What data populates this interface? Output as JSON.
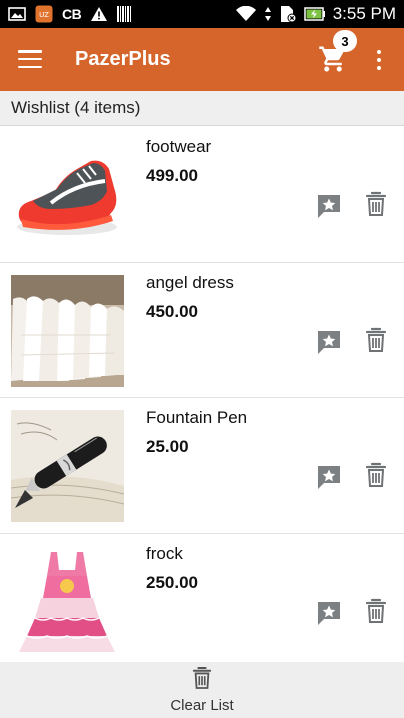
{
  "status_bar": {
    "time": "3:55 PM",
    "carrier_text": "CB",
    "icons": [
      "gallery-icon",
      "app-notification-icon",
      "carrier-cb-icon",
      "warning-icon",
      "barcode-icon",
      "wifi-icon",
      "data-arrows-icon",
      "no-sim-icon",
      "battery-charging-icon"
    ]
  },
  "app_bar": {
    "title": "PazerPlus",
    "cart_count": "3",
    "menu_icon": "hamburger-menu-icon",
    "cart_icon": "shopping-cart-icon",
    "overflow_icon": "more-vert-icon",
    "background": "#d5652b"
  },
  "wishlist": {
    "header": "Wishlist (4 items)",
    "items": [
      {
        "name": "footwear",
        "price": "499.00",
        "image": "red-sneaker-image"
      },
      {
        "name": "angel dress",
        "price": "450.00",
        "image": "white-dresses-image"
      },
      {
        "name": "Fountain Pen",
        "price": "25.00",
        "image": "fountain-pen-image"
      },
      {
        "name": "frock",
        "price": "250.00",
        "image": "pink-frock-image"
      }
    ],
    "action_icons": [
      "star-feedback-icon",
      "trash-icon"
    ]
  },
  "bottom_bar": {
    "label": "Clear List",
    "icon": "trash-icon"
  }
}
